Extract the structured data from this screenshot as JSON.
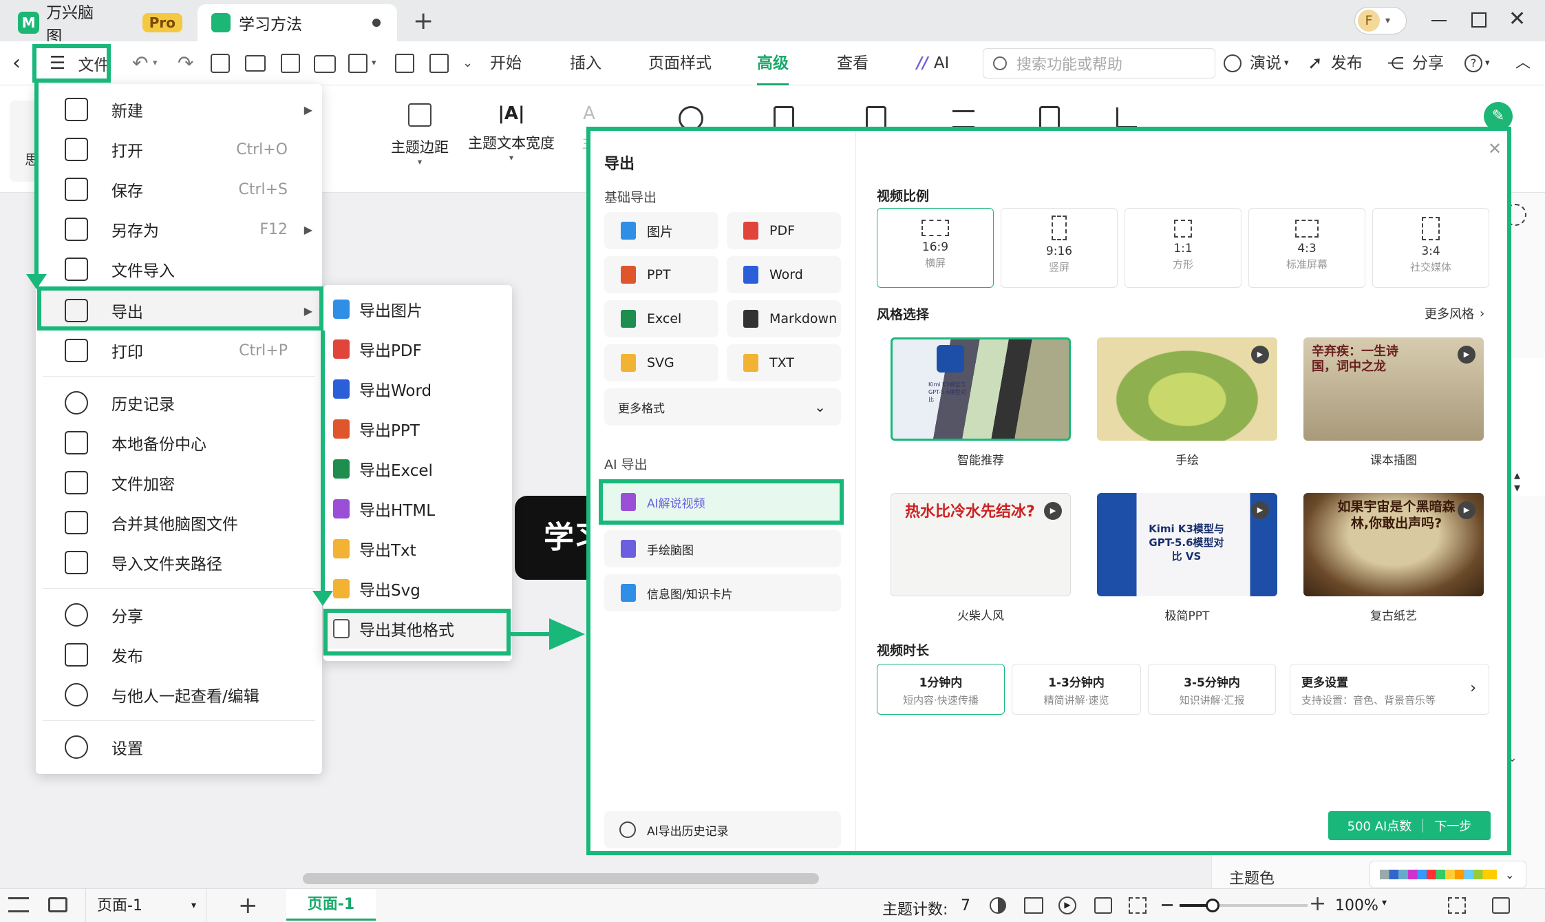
{
  "titlebar": {
    "app_tab": {
      "label": "万兴脑图",
      "badge": "Pro"
    },
    "doc_tab": {
      "label": "学习方法"
    },
    "user_initial": "F"
  },
  "menubar": {
    "file_label": "文件",
    "items": [
      {
        "label": "开始"
      },
      {
        "label": "插入"
      },
      {
        "label": "页面样式"
      },
      {
        "label": "高级"
      },
      {
        "label": "查看"
      },
      {
        "label": "AI"
      }
    ],
    "search_placeholder": "搜索功能或帮助",
    "right_items": [
      {
        "label": "演说"
      },
      {
        "label": "发布"
      },
      {
        "label": "分享"
      }
    ]
  },
  "ribbon": {
    "left_cut_label": "思",
    "items": [
      {
        "label": "主题边距"
      },
      {
        "label": "主题文本宽度"
      },
      {
        "label": "主"
      }
    ]
  },
  "file_menu": {
    "items": [
      {
        "label": "新建",
        "shortcut": ""
      },
      {
        "label": "打开",
        "shortcut": "Ctrl+O"
      },
      {
        "label": "保存",
        "shortcut": "Ctrl+S"
      },
      {
        "label": "另存为",
        "shortcut": "F12"
      },
      {
        "label": "文件导入",
        "shortcut": ""
      },
      {
        "label": "导出",
        "shortcut": ""
      },
      {
        "label": "打印",
        "shortcut": "Ctrl+P"
      },
      {
        "label": "历史记录",
        "shortcut": ""
      },
      {
        "label": "本地备份中心",
        "shortcut": ""
      },
      {
        "label": "文件加密",
        "shortcut": ""
      },
      {
        "label": "合并其他脑图文件",
        "shortcut": ""
      },
      {
        "label": "导入文件夹路径",
        "shortcut": ""
      },
      {
        "label": "分享",
        "shortcut": ""
      },
      {
        "label": "发布",
        "shortcut": ""
      },
      {
        "label": "与他人一起查看/编辑",
        "shortcut": ""
      },
      {
        "label": "设置",
        "shortcut": ""
      }
    ]
  },
  "export_submenu": {
    "items": [
      {
        "label": "导出图片",
        "color": "#2f8fe6"
      },
      {
        "label": "导出PDF",
        "color": "#e0443a"
      },
      {
        "label": "导出Word",
        "color": "#2b5fd9"
      },
      {
        "label": "导出PPT",
        "color": "#e0562c"
      },
      {
        "label": "导出Excel",
        "color": "#1e8e4e"
      },
      {
        "label": "导出HTML",
        "color": "#9b4fd6"
      },
      {
        "label": "导出Txt",
        "color": "#f2b233"
      },
      {
        "label": "导出Svg",
        "color": "#f2b233"
      },
      {
        "label": "导出其他格式",
        "color": "#555555"
      }
    ]
  },
  "canvas": {
    "node_text": "学习"
  },
  "export_panel": {
    "title": "导出",
    "basic_title": "基础导出",
    "formats": [
      {
        "label": "图片",
        "color": "#2f8fe6"
      },
      {
        "label": "PDF",
        "color": "#e0443a"
      },
      {
        "label": "PPT",
        "color": "#e0562c"
      },
      {
        "label": "Word",
        "color": "#2b5fd9"
      },
      {
        "label": "Excel",
        "color": "#1e8e4e"
      },
      {
        "label": "Markdown",
        "color": "#333333"
      },
      {
        "label": "SVG",
        "color": "#f2b233"
      },
      {
        "label": "TXT",
        "color": "#f2b233"
      }
    ],
    "more_formats": "更多格式",
    "ai_title": "AI 导出",
    "ai_items": [
      {
        "label": "AI解说视频",
        "color": "#9b4fd6"
      },
      {
        "label": "手绘脑图",
        "color": "#6b5fe0"
      },
      {
        "label": "信息图/知识卡片",
        "color": "#2f8fe6"
      }
    ],
    "history": "AI导出历史记录",
    "ratio_title": "视频比例",
    "ratios": [
      {
        "value": "16:9",
        "desc": "横屏"
      },
      {
        "value": "9:16",
        "desc": "竖屏"
      },
      {
        "value": "1:1",
        "desc": "方形"
      },
      {
        "value": "4:3",
        "desc": "标准屏幕"
      },
      {
        "value": "3:4",
        "desc": "社交媒体"
      }
    ],
    "style_title": "风格选择",
    "more_styles": "更多风格",
    "styles": [
      {
        "label": "智能推荐",
        "thumb_text": "Kimi K3模型与GPT-5.6模型对比"
      },
      {
        "label": "手绘",
        "thumb_text": ""
      },
      {
        "label": "课本插图",
        "thumb_text": "辛弃疾：一生诗国，词中之龙"
      },
      {
        "label": "火柴人风",
        "thumb_text": "热水比冷水先结冰?"
      },
      {
        "label": "极简PPT",
        "thumb_text": "Kimi K3模型与GPT-5.6模型对比 VS"
      },
      {
        "label": "复古纸艺",
        "thumb_text": "如果宇宙是个黑暗森林,你敢出声吗?"
      }
    ],
    "duration_title": "视频时长",
    "durations": [
      {
        "value": "1分钟内",
        "desc": "短内容·快速传播"
      },
      {
        "value": "1-3分钟内",
        "desc": "精简讲解·速览"
      },
      {
        "value": "3-5分钟内",
        "desc": "知识讲解·汇报"
      }
    ],
    "more_settings": {
      "title": "更多设置",
      "desc": "支持设置：音色、背景音乐等"
    },
    "ai_points": "500 AI点数",
    "next": "下一步"
  },
  "right_panel": {
    "theme_color": "主题色"
  },
  "statusbar": {
    "page_select": "页面-1",
    "page_tab": "页面-1",
    "topic_count_label": "主题计数:",
    "topic_count": "7",
    "zoom": "100%"
  },
  "colors": {
    "accent": "#19b87a",
    "brand_green": "#1cb675"
  }
}
